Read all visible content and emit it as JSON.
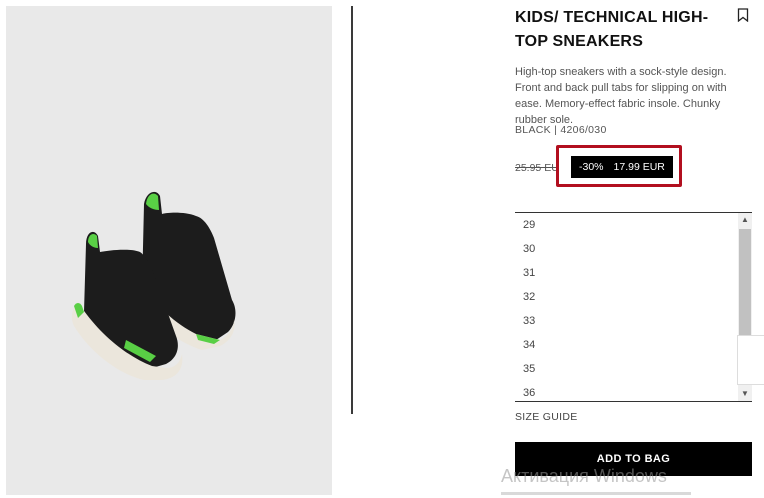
{
  "product": {
    "title": "KIDS/ TECHNICAL HIGH-TOP SNEAKERS",
    "description": "High-top sneakers with a sock-style design. Front and back pull tabs for slipping on with ease. Memory-effect fabric insole. Chunky rubber sole.",
    "color_ref": "BLACK | 4206/030",
    "image_icon": "sneakers-photo"
  },
  "price": {
    "old": "25.95 EUR",
    "discount": "-30%",
    "current": "17.99 EUR",
    "highlight_color": "#b20f1f"
  },
  "sizes": [
    "29",
    "30",
    "31",
    "32",
    "33",
    "34",
    "35",
    "36"
  ],
  "size_guide_label": "SIZE GUIDE",
  "add_to_bag_label": "ADD TO BAG",
  "watermark": "Активация Windows",
  "colors": {
    "sneaker_body": "#1c1c1c",
    "sole": "#ebe6dc",
    "accent_green": "#59cf45",
    "background": "#e9e9e9"
  }
}
